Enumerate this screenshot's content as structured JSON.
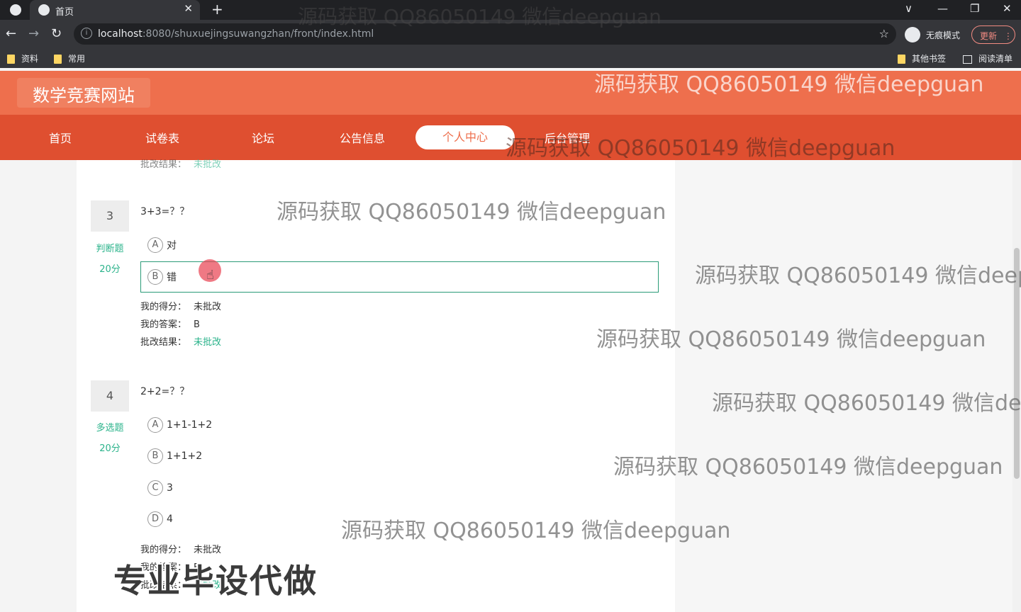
{
  "browser": {
    "tab_title": "首页",
    "close_glyph": "✕",
    "newtab_glyph": "+",
    "url_host": "localhost",
    "url_rest": ":8080/shuxuejingsuwangzhan/front/index.html",
    "incognito_label": "无痕模式",
    "update_label": "更新",
    "bookmarks": [
      "资料",
      "常用"
    ],
    "other_bookmarks": "其他书签",
    "reading_list": "阅读清单",
    "window_controls": {
      "chevron": "∨",
      "minimize": "—",
      "restore": "❐",
      "close": "✕"
    },
    "nav_glyphs": {
      "back": "←",
      "forward": "→",
      "reload": "↻",
      "star": "☆",
      "info": "i"
    }
  },
  "site": {
    "title": "数学竞赛网站",
    "nav": [
      "首页",
      "试卷表",
      "论坛",
      "公告信息",
      "个人中心",
      "后台管理"
    ],
    "active_nav": "个人中心"
  },
  "partial_top": {
    "label": "批改结果：",
    "value": "未批改"
  },
  "questions": [
    {
      "number": "3",
      "type": "判断题",
      "score": "20分",
      "text": "3+3=？？",
      "options": [
        {
          "letter": "A",
          "text": "对"
        },
        {
          "letter": "B",
          "text": "错"
        }
      ],
      "selected": "B",
      "my_score_label": "我的得分：",
      "my_score": "未批改",
      "my_answer_label": "我的答案：",
      "my_answer": "B",
      "result_label": "批改结果：",
      "result": "未批改"
    },
    {
      "number": "4",
      "type": "多选题",
      "score": "20分",
      "text": "2+2=？？",
      "options": [
        {
          "letter": "A",
          "text": "1+1-1+2"
        },
        {
          "letter": "B",
          "text": "1+1+2"
        },
        {
          "letter": "C",
          "text": "3"
        },
        {
          "letter": "D",
          "text": "4"
        }
      ],
      "my_score_label": "我的得分：",
      "my_score": "未批改",
      "my_answer_label": "我的答案：",
      "my_answer": "B",
      "result_label": "批改结果：",
      "result": "未批改"
    }
  ],
  "cursor_glyph": "☝",
  "watermark": "源码获取 QQ86050149 微信deepguan",
  "watermark_cut1": "源码获取 QQ86050149 微信deep",
  "watermark_cut2": "源码获取 QQ86050149 微信dee",
  "overlay_text": "专业毕设代做"
}
